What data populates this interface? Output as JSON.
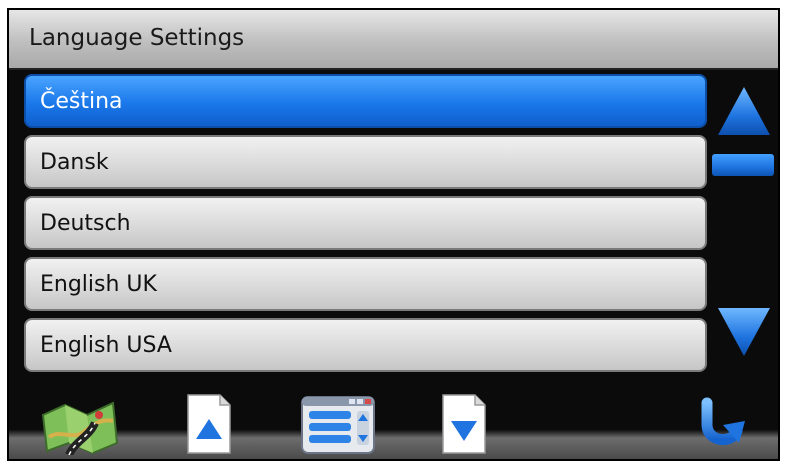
{
  "header": {
    "title": "Language Settings"
  },
  "languages": {
    "items": [
      {
        "label": "Čeština",
        "selected": true
      },
      {
        "label": "Dansk",
        "selected": false
      },
      {
        "label": "Deutsch",
        "selected": false
      },
      {
        "label": "English UK",
        "selected": false
      },
      {
        "label": "English USA",
        "selected": false
      }
    ]
  },
  "scrollbar": {
    "up_icon": "triangle-up-icon",
    "down_icon": "triangle-down-icon",
    "thumb_icon": "scroll-thumb"
  },
  "toolbar": {
    "buttons": [
      {
        "icon": "map-icon"
      },
      {
        "icon": "page-up-icon"
      },
      {
        "icon": "list-menu-icon"
      },
      {
        "icon": "page-down-icon"
      },
      {
        "icon": "back-arrow-icon"
      }
    ]
  },
  "colors": {
    "accent": "#1b78ea",
    "row_bg": "#d8d8d8",
    "background": "#0b0b0b"
  }
}
